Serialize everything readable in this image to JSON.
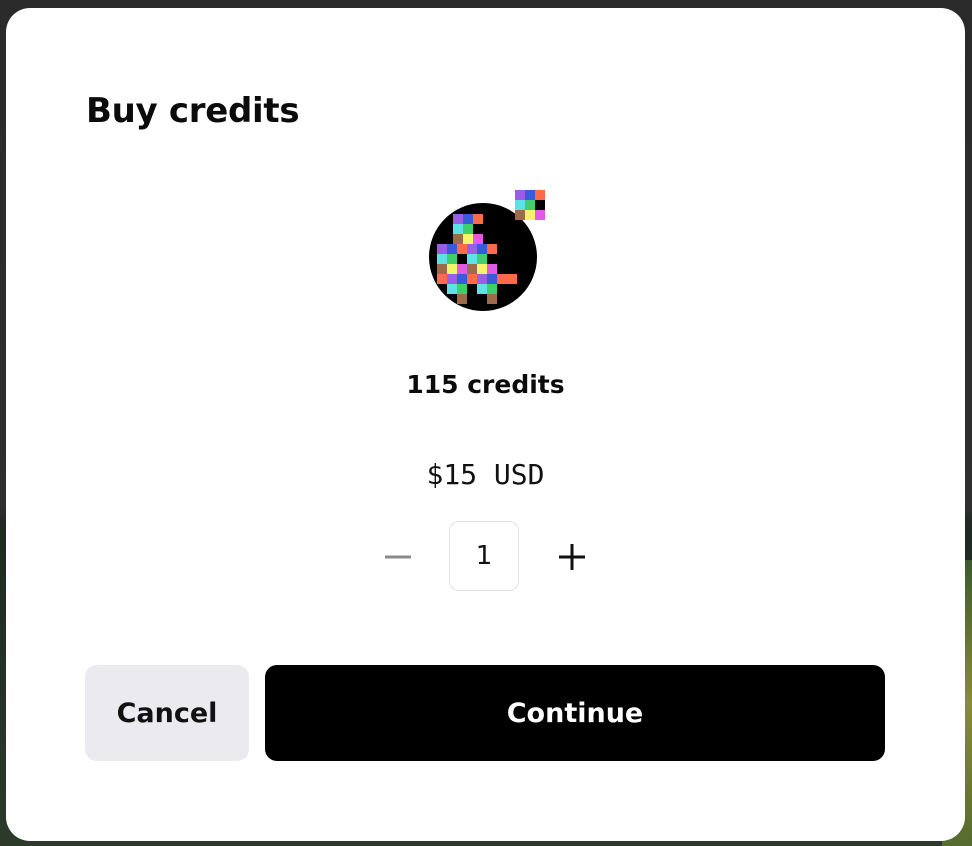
{
  "dialog": {
    "title": "Buy credits",
    "credits_label": "115 credits",
    "price": "$15 USD",
    "quantity": "1",
    "cancel_label": "Cancel",
    "continue_label": "Continue"
  },
  "icons": {
    "token": "pixel-art-token-avatar",
    "decrement": "minus-icon",
    "increment": "plus-icon"
  },
  "colors": {
    "primary_button": "#000000",
    "secondary_button": "#ebebef",
    "decrement_disabled": "#8a8a8a",
    "pixel_palette": [
      "#9b5de5",
      "#3a5bd9",
      "#ff6b4a",
      "#5ce1e6",
      "#3fcf6a",
      "#f4f46a",
      "#e05ae6",
      "#9e6b4a"
    ]
  }
}
